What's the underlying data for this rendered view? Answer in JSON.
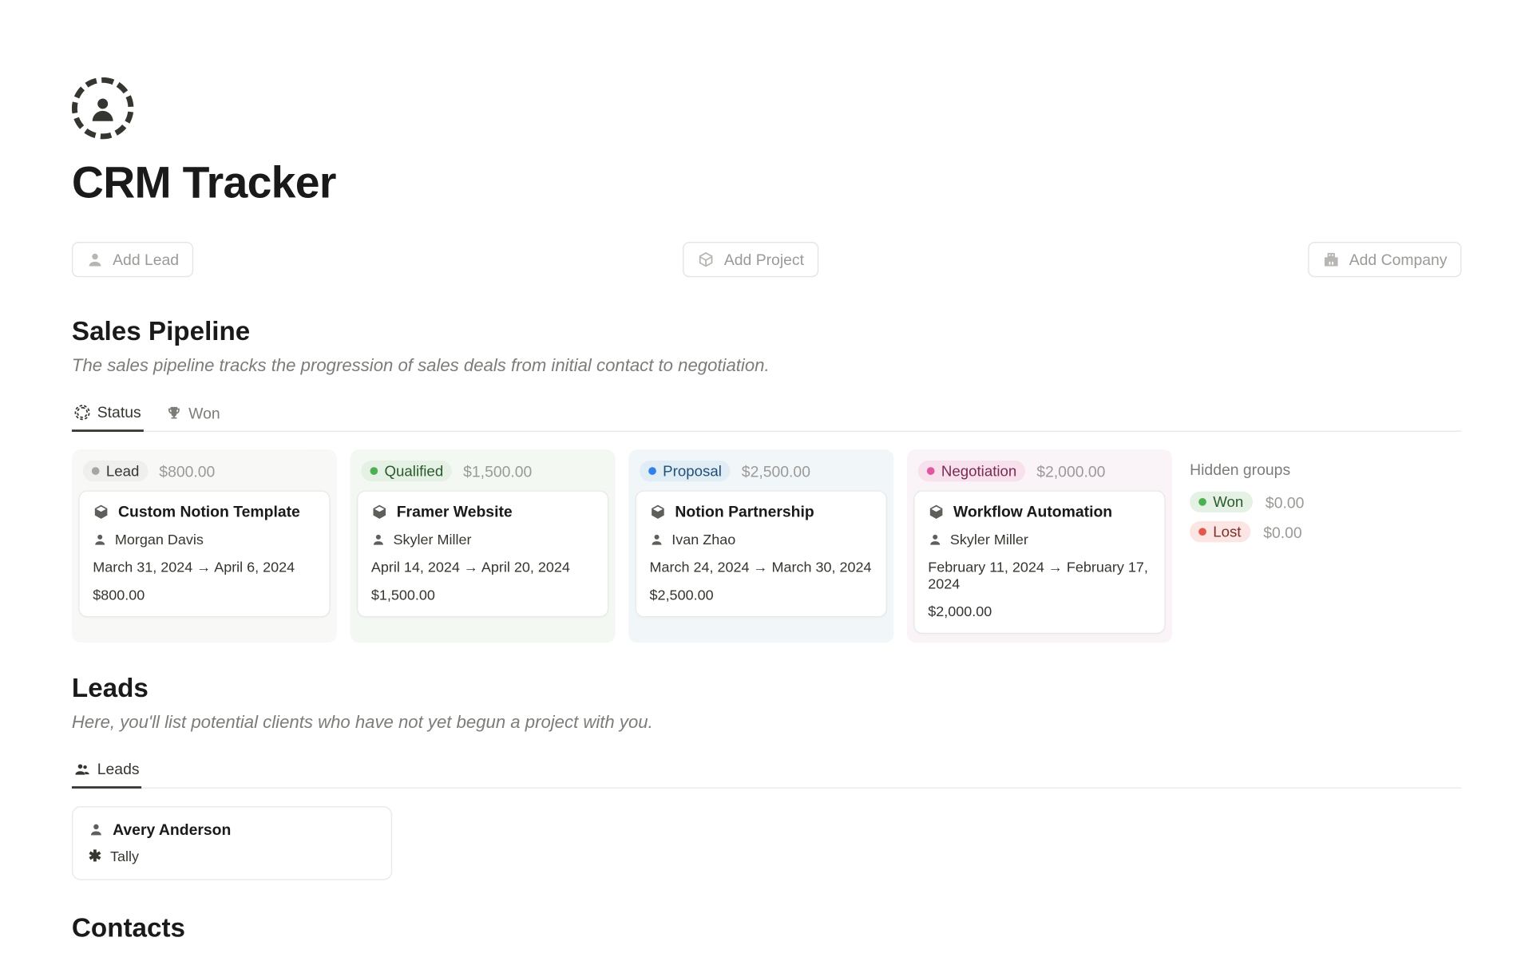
{
  "page": {
    "title": "CRM Tracker"
  },
  "actions": {
    "add_lead": "Add Lead",
    "add_project": "Add Project",
    "add_company": "Add Company"
  },
  "pipeline": {
    "title": "Sales Pipeline",
    "description": "The sales pipeline tracks the progression of sales deals from initial contact to negotiation.",
    "tabs": {
      "status": "Status",
      "won": "Won"
    },
    "columns": {
      "lead": {
        "label": "Lead",
        "amount": "$800.00"
      },
      "qualified": {
        "label": "Qualified",
        "amount": "$1,500.00"
      },
      "proposal": {
        "label": "Proposal",
        "amount": "$2,500.00"
      },
      "negotiation": {
        "label": "Negotiation",
        "amount": "$2,000.00"
      }
    },
    "cards": {
      "lead": {
        "title": "Custom Notion Template",
        "contact": "Morgan Davis",
        "dates": "March 31, 2024 → April 6, 2024",
        "amount": "$800.00"
      },
      "qualified": {
        "title": "Framer Website",
        "contact": "Skyler Miller",
        "dates": "April 14, 2024 → April 20, 2024",
        "amount": "$1,500.00"
      },
      "proposal": {
        "title": "Notion Partnership",
        "contact": "Ivan Zhao",
        "dates": "March 24, 2024 → March 30, 2024",
        "amount": "$2,500.00"
      },
      "negotiation": {
        "title": "Workflow Automation",
        "contact": "Skyler Miller",
        "dates": "February 11, 2024 → February 17, 2024",
        "amount": "$2,000.00"
      }
    },
    "hidden": {
      "title": "Hidden groups",
      "won": {
        "label": "Won",
        "amount": "$0.00"
      },
      "lost": {
        "label": "Lost",
        "amount": "$0.00"
      }
    }
  },
  "leads": {
    "title": "Leads",
    "description": "Here, you'll list potential clients who have not yet begun a project with you.",
    "tab": "Leads",
    "card": {
      "name": "Avery Anderson",
      "company": "Tally"
    }
  },
  "contacts": {
    "title": "Contacts"
  }
}
